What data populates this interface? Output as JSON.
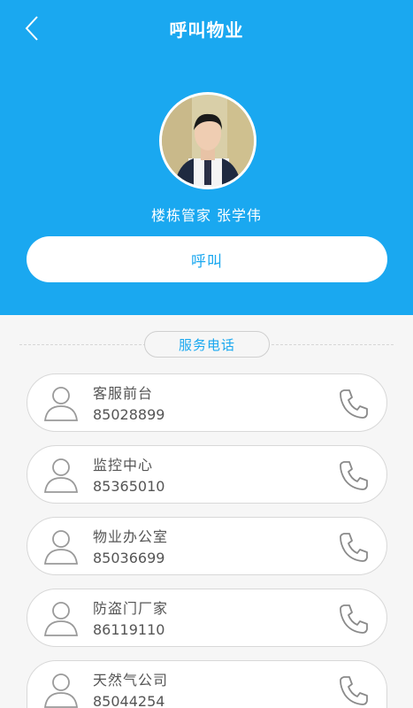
{
  "header": {
    "title": "呼叫物业",
    "back_icon": "chevron-left-icon"
  },
  "manager": {
    "label": "楼栋管家  张学伟",
    "call_label": "呼叫"
  },
  "services": {
    "title": "服务电话",
    "items": [
      {
        "name": "客服前台",
        "phone": "85028899"
      },
      {
        "name": "监控中心",
        "phone": "85365010"
      },
      {
        "name": "物业办公室",
        "phone": "85036699"
      },
      {
        "name": "防盗门厂家",
        "phone": "86119110"
      },
      {
        "name": "天然气公司",
        "phone": "85044254"
      }
    ]
  },
  "colors": {
    "accent": "#1aa8f0",
    "background": "#f6f6f6",
    "text": "#555555"
  }
}
